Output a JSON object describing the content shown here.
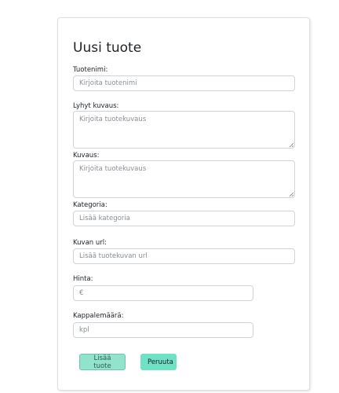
{
  "form": {
    "title": "Uusi tuote",
    "fields": {
      "name": {
        "label": "Tuotenimi:",
        "placeholder": "Kirjoita tuotenimi"
      },
      "short_description": {
        "label": "Lyhyt kuvaus:",
        "placeholder": "Kirjoita tuotekuvaus"
      },
      "description": {
        "label": "Kuvaus:",
        "placeholder": "Kirjoita tuotekuvaus"
      },
      "category": {
        "label": "Kategoria:",
        "placeholder": "Lisää kategoria"
      },
      "image_url": {
        "label": "Kuvan url:",
        "placeholder": "Lisää tuotekuvan url"
      },
      "price": {
        "label": "Hinta:",
        "placeholder": "€"
      },
      "quantity": {
        "label": "Kappalemäärä:",
        "placeholder": "kpl"
      }
    },
    "buttons": {
      "add_label": "Lisää tuote",
      "cancel_label": "Peruuta"
    }
  }
}
